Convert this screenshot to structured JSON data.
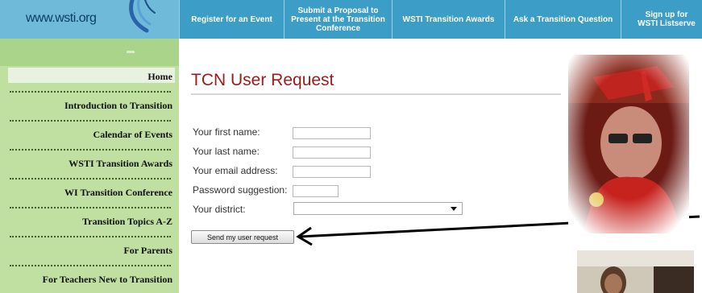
{
  "site": {
    "logo_text": "www.wsti.org"
  },
  "topnav": [
    {
      "label": "Register for an Event"
    },
    {
      "label": "Submit a Proposal to Present at the Transition Conference"
    },
    {
      "label": "WSTI Transition Awards"
    },
    {
      "label": "Ask a Transition Question"
    },
    {
      "label": "Sign up for WSTI Listserve"
    }
  ],
  "sidebar": {
    "items": [
      {
        "label": "Home"
      },
      {
        "label": "Introduction to Transition"
      },
      {
        "label": "Calendar of Events"
      },
      {
        "label": "WSTI Transition Awards"
      },
      {
        "label": "WI Transition Conference"
      },
      {
        "label": "Transition Topics A-Z"
      },
      {
        "label": "For Parents"
      },
      {
        "label": "For Teachers New to Transition"
      }
    ]
  },
  "form": {
    "title": "TCN User Request",
    "first_name_label": "Your first name:",
    "last_name_label": "Your last name:",
    "email_label": "Your email address:",
    "password_label": "Password suggestion:",
    "district_label": "Your district:",
    "district_value": "",
    "submit_label": "Send my user request"
  },
  "colors": {
    "topbar": "#3c9ec6",
    "logo_bg": "#6fbad9",
    "sidebar_bg": "#bfe0a0",
    "title_red": "#9b1b1b"
  }
}
